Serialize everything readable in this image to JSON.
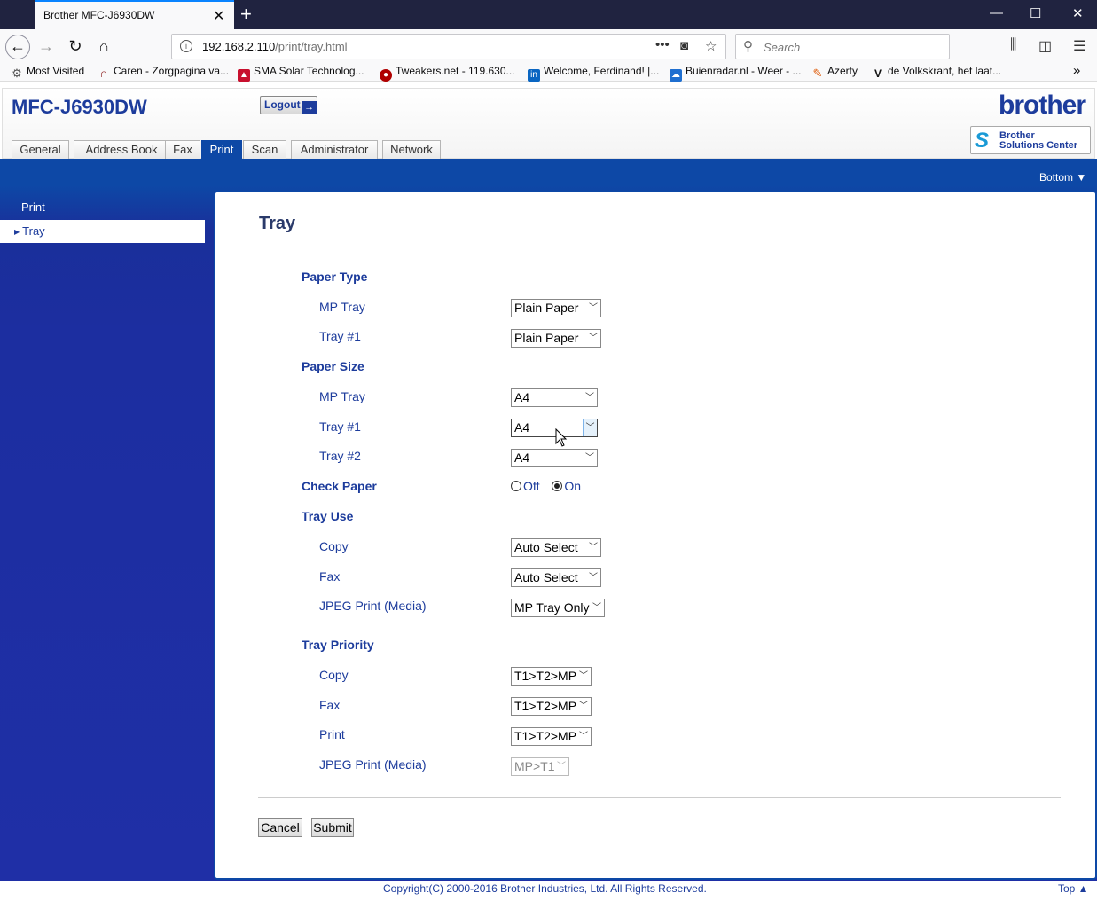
{
  "browser": {
    "tab_title": "Brother MFC-J6930DW",
    "tab_close": "✕",
    "new_tab": "+",
    "win_minimize": "—",
    "win_maximize": "☐",
    "win_close": "✕",
    "url_host": "192.168.2.110",
    "url_path": "/print/tray.html",
    "search_placeholder": "Search",
    "bookmarks": [
      {
        "label": "Most Visited",
        "icon": "gear-icon",
        "color": "#555555"
      },
      {
        "label": "Caren - Zorgpagina va...",
        "icon": "headphones-icon",
        "color": "#8b1a1a"
      },
      {
        "label": "SMA Solar Technolog...",
        "icon": "sma-logo-icon",
        "color": "#c8102e"
      },
      {
        "label": "Tweakers.net - 119.630...",
        "icon": "tweakers-icon",
        "color": "#b00000"
      },
      {
        "label": "Welcome, Ferdinand! |...",
        "icon": "linkedin-icon",
        "color": "#0a66c2"
      },
      {
        "label": "Buienradar.nl - Weer - ...",
        "icon": "buienradar-icon",
        "color": "#1f6fd0"
      },
      {
        "label": "Azerty",
        "icon": "azerty-icon",
        "color": "#e06010"
      },
      {
        "label": "de Volkskrant, het laat...",
        "icon": "volkskrant-icon",
        "color": "#111111"
      }
    ]
  },
  "header": {
    "model": "MFC-J6930DW",
    "logout_label": "Logout",
    "brand": "brother",
    "solutions_line1": "Brother",
    "solutions_line2": "Solutions Center"
  },
  "tabs": [
    {
      "label": "General",
      "active": false
    },
    {
      "label": "Address Book",
      "active": false
    },
    {
      "label": "Fax",
      "active": false
    },
    {
      "label": "Print",
      "active": true
    },
    {
      "label": "Scan",
      "active": false
    },
    {
      "label": "Administrator",
      "active": false
    },
    {
      "label": "Network",
      "active": false
    }
  ],
  "nav": {
    "bottom_link": "Bottom ▼",
    "top_link": "Top ▲"
  },
  "sidebar": {
    "items": [
      {
        "label": "Print",
        "active": false
      },
      {
        "label": "Tray",
        "active": true
      }
    ]
  },
  "form": {
    "title": "Tray",
    "paper_type": {
      "heading": "Paper Type",
      "mp_tray_label": "MP Tray",
      "mp_tray_value": "Plain Paper",
      "tray1_label": "Tray #1",
      "tray1_value": "Plain Paper"
    },
    "paper_size": {
      "heading": "Paper Size",
      "mp_tray_label": "MP Tray",
      "mp_tray_value": "A4",
      "tray1_label": "Tray #1",
      "tray1_value": "A4",
      "tray2_label": "Tray #2",
      "tray2_value": "A4"
    },
    "check_paper": {
      "heading": "Check Paper",
      "off_label": "Off",
      "on_label": "On",
      "selected": "On"
    },
    "tray_use": {
      "heading": "Tray Use",
      "copy_label": "Copy",
      "copy_value": "Auto Select",
      "fax_label": "Fax",
      "fax_value": "Auto Select",
      "jpeg_label": "JPEG Print (Media)",
      "jpeg_value": "MP Tray Only"
    },
    "tray_priority": {
      "heading": "Tray Priority",
      "copy_label": "Copy",
      "copy_value": "T1>T2>MP",
      "fax_label": "Fax",
      "fax_value": "T1>T2>MP",
      "print_label": "Print",
      "print_value": "T1>T2>MP",
      "jpeg_label": "JPEG Print (Media)",
      "jpeg_value": "MP>T1"
    },
    "cancel_label": "Cancel",
    "submit_label": "Submit"
  },
  "footer": {
    "copyright": "Copyright(C) 2000-2016 Brother Industries, Ltd. All Rights Reserved."
  },
  "colors": {
    "brother_blue": "#1d3c9c",
    "tab_active": "#0d48a6",
    "firefox_titlebar": "#202340"
  }
}
